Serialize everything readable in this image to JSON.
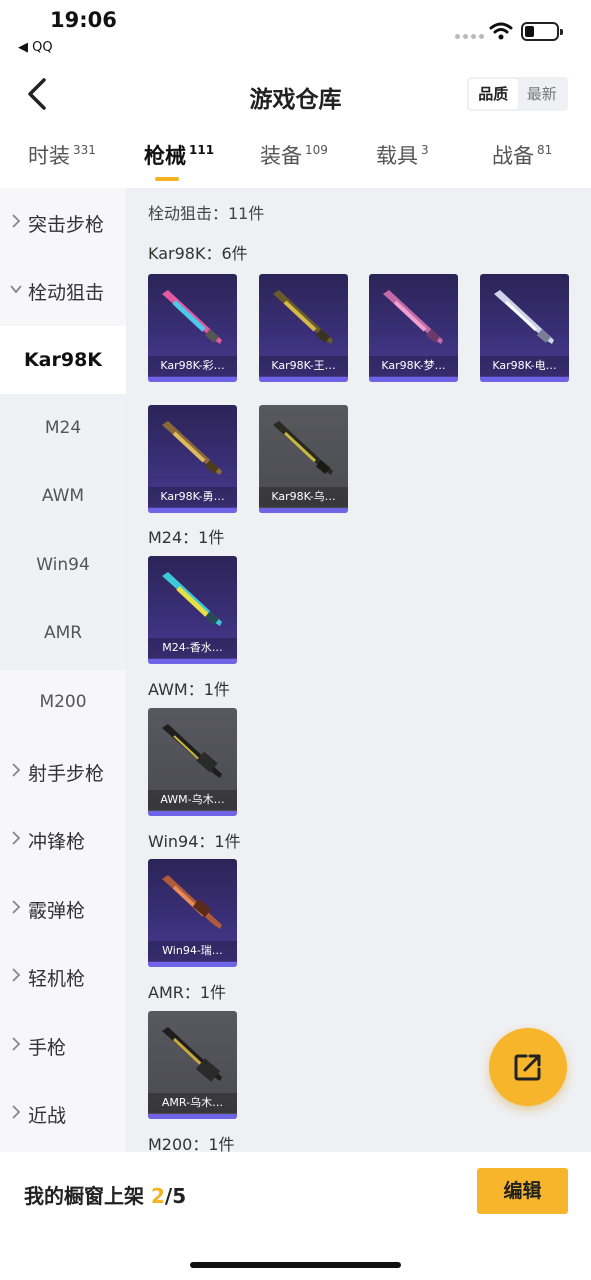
{
  "status_bar": {
    "time": "19:06",
    "back_app": "◀ QQ"
  },
  "header": {
    "title": "游戏仓库",
    "sort_options": [
      "品质",
      "最新"
    ],
    "active_sort": "品质"
  },
  "tabs": [
    {
      "label": "时装",
      "count": "331"
    },
    {
      "label": "枪械",
      "count": "111"
    },
    {
      "label": "装备",
      "count": "109"
    },
    {
      "label": "载具",
      "count": "3"
    },
    {
      "label": "战备",
      "count": "81"
    }
  ],
  "active_tab": "枪械",
  "sidebar": {
    "categories": [
      {
        "label": "突击步枪",
        "expanded": false
      },
      {
        "label": "栓动狙击",
        "expanded": true,
        "subitems": [
          "Kar98K",
          "M24",
          "AWM",
          "Win94",
          "AMR",
          "M200"
        ]
      },
      {
        "label": "射手步枪",
        "expanded": false
      },
      {
        "label": "冲锋枪",
        "expanded": false
      },
      {
        "label": "霰弹枪",
        "expanded": false
      },
      {
        "label": "轻机枪",
        "expanded": false
      },
      {
        "label": "手枪",
        "expanded": false
      },
      {
        "label": "近战",
        "expanded": false
      }
    ],
    "active_subitem": "Kar98K"
  },
  "content": {
    "summary": "栓动狙击：11件",
    "groups": [
      {
        "label": "Kar98K：6件",
        "items": [
          {
            "name": "Kar98K-彩…",
            "rarity": "purple"
          },
          {
            "name": "Kar98K-王…",
            "rarity": "purple"
          },
          {
            "name": "Kar98K-梦…",
            "rarity": "purple"
          },
          {
            "name": "Kar98K-电…",
            "rarity": "purple"
          },
          {
            "name": "Kar98K-勇…",
            "rarity": "purple"
          },
          {
            "name": "Kar98K-乌…",
            "rarity": "grey"
          }
        ]
      },
      {
        "label": "M24：1件",
        "items": [
          {
            "name": "M24-香水…",
            "rarity": "purple"
          }
        ]
      },
      {
        "label": "AWM：1件",
        "items": [
          {
            "name": "AWM-乌木…",
            "rarity": "grey"
          }
        ]
      },
      {
        "label": "Win94：1件",
        "items": [
          {
            "name": "Win94-瑞…",
            "rarity": "purple"
          }
        ]
      },
      {
        "label": "AMR：1件",
        "items": [
          {
            "name": "AMR-乌木…",
            "rarity": "grey"
          }
        ]
      },
      {
        "label": "M200：1件",
        "items": []
      }
    ]
  },
  "bottom_bar": {
    "showcase_prefix": "我的橱窗上架 ",
    "showcase_current": "2",
    "showcase_total": "/5",
    "edit_label": "编辑"
  },
  "colors": {
    "accent": "#f7b52c",
    "purple_rarity": "#6f63e6",
    "content_bg": "#eff0f3"
  }
}
